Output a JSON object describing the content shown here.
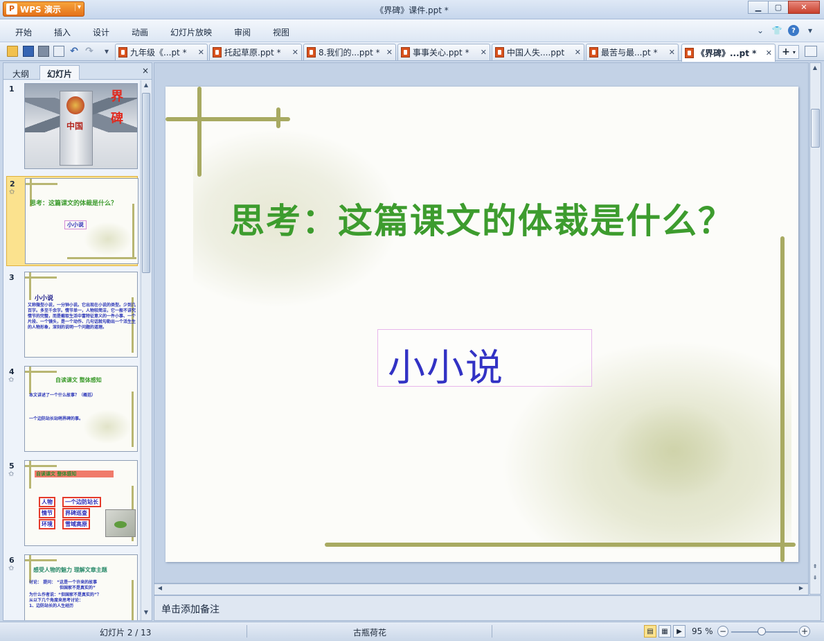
{
  "app": {
    "name": "WPS 演示",
    "window_title": "《界碑》课件.ppt *"
  },
  "menu": [
    "开始",
    "插入",
    "设计",
    "动画",
    "幻灯片放映",
    "审阅",
    "视图"
  ],
  "tabs": [
    {
      "label": "九年级《...pt *",
      "active": false
    },
    {
      "label": "托起草原.ppt *",
      "active": false
    },
    {
      "label": "8.我们的...ppt *",
      "active": false
    },
    {
      "label": "事事关心.ppt *",
      "active": false
    },
    {
      "label": "中国人失....ppt",
      "active": false
    },
    {
      "label": "最苦与最...pt *",
      "active": false
    },
    {
      "label": "《界碑》...pt *",
      "active": true
    }
  ],
  "left_panel": {
    "tab_outline": "大纲",
    "tab_slides": "幻灯片",
    "close": "×",
    "thumbnails": [
      {
        "num": "1",
        "text_a": "界",
        "text_b": "碑",
        "stele_text": "中国"
      },
      {
        "num": "2",
        "title": "思考：这篇课文的体裁是什么？",
        "box": "小小说"
      },
      {
        "num": "3",
        "title": "小小说",
        "body": "又称微型小说，一分钟小说。它出现在小说的类型。少到几百字。多至千余字。情节单一，人物较简洁，它一般不讲究情节的完整，而是截取生活中富特征意义的一件小事、一个片段、一个镜头，是一个动作、几句话就勾勒出一个活生生的人物形象，深刻的说明一个问题的道理。"
      },
      {
        "num": "4",
        "title": "自读课文 整体感知",
        "q1": "本文讲述了一个什么故事？（概括）",
        "q2": "一个边防站长站哨界碑的事。"
      },
      {
        "num": "5",
        "title": "自读课文 整体感知",
        "labels": [
          "人物",
          "情节",
          "环境"
        ],
        "values": [
          "一个边防站长",
          "界碑巡查",
          "雪域高原"
        ]
      },
      {
        "num": "6",
        "title": "感受人物的魅力 理解文章主题",
        "lines": [
          "讨论：  提问：  “这是一个许来的故事",
          "但国家不是真实的”",
          "为什么作者说：“但国家不是真实的”？",
          "从以下几个角度来思考讨论：",
          "1、边防站长的人生经历"
        ]
      }
    ]
  },
  "slide": {
    "title": "思考：这篇课文的体裁是什么？",
    "box_text": "小小说"
  },
  "notes_placeholder": "单击添加备注",
  "status": {
    "slide_info": "幻灯片 2 / 13",
    "theme": "古瓶荷花",
    "zoom": "95 %"
  }
}
